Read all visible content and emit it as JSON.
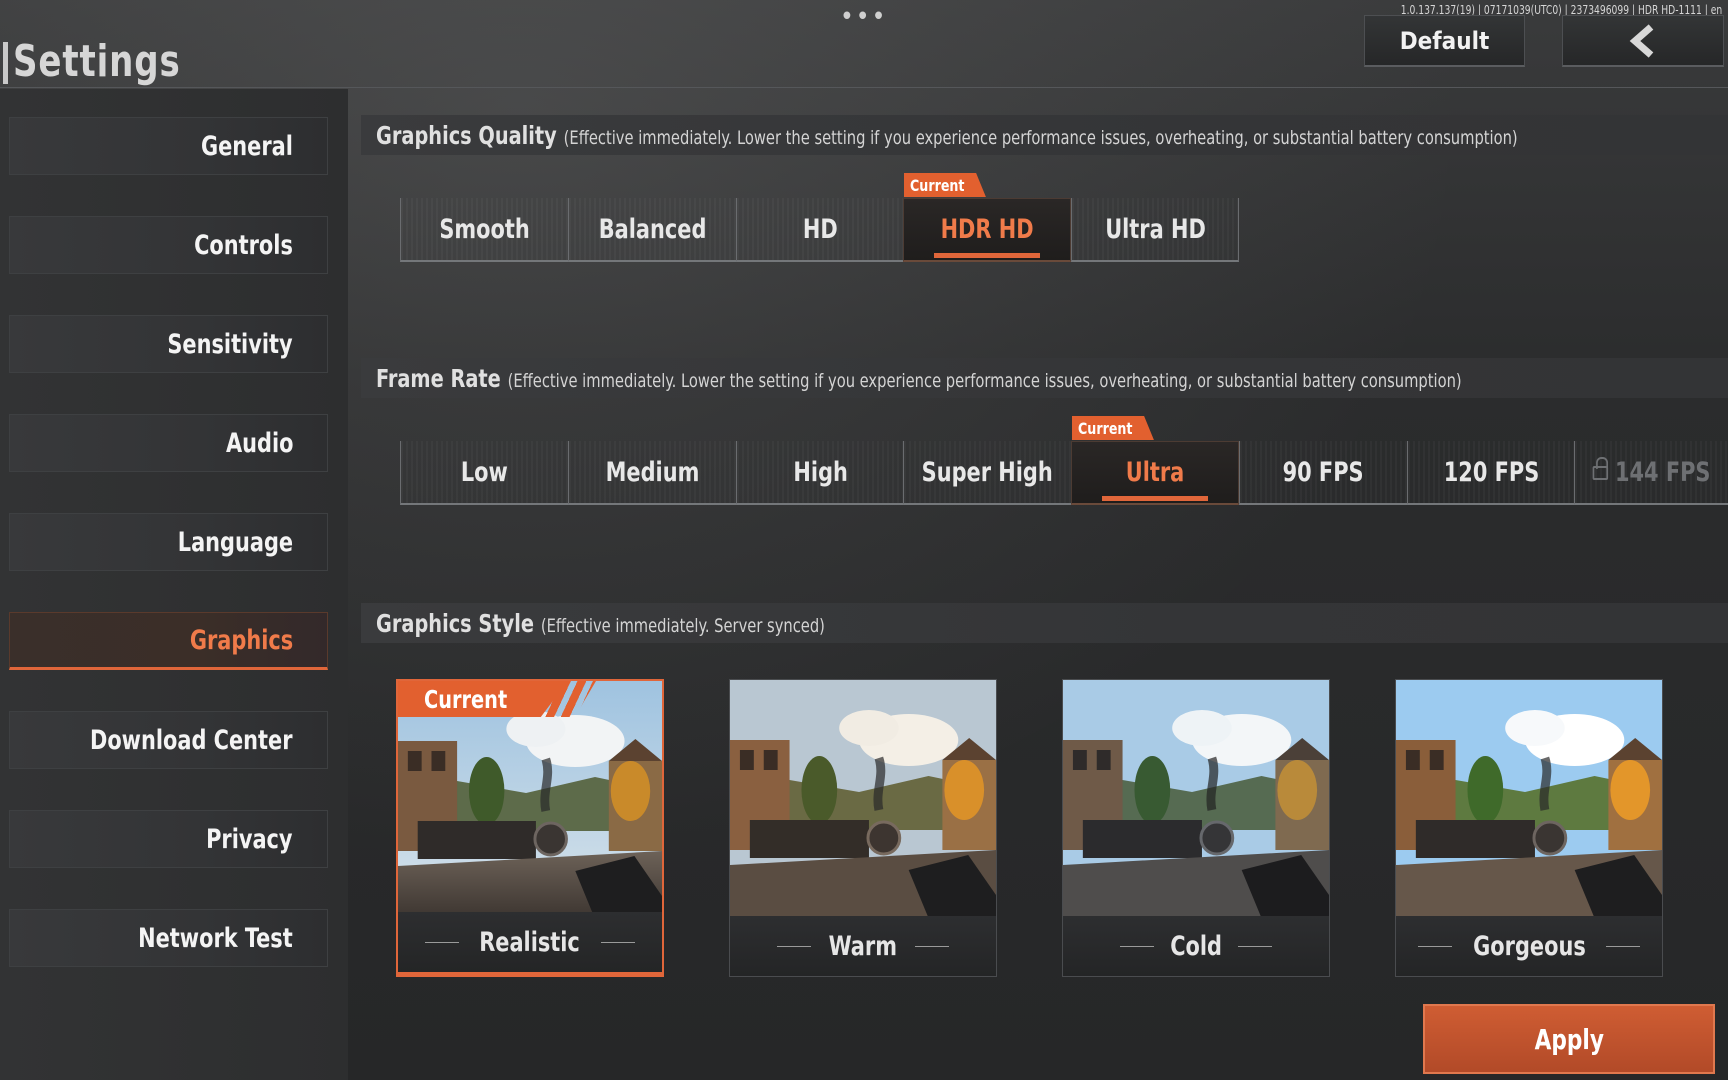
{
  "header": {
    "title": "Settings",
    "more_icon": "ellipsis-icon",
    "version_info": "1.0.137.137(19) | 07171039(UTC0) | 2373496099 | HDR HD-1111 | en",
    "default_label": "Default",
    "back_icon": "chevron-left-icon"
  },
  "sidebar": {
    "items": [
      {
        "label": "General"
      },
      {
        "label": "Controls"
      },
      {
        "label": "Sensitivity"
      },
      {
        "label": "Audio"
      },
      {
        "label": "Language"
      },
      {
        "label": "Graphics",
        "active": true
      },
      {
        "label": "Download Center"
      },
      {
        "label": "Privacy"
      },
      {
        "label": "Network Test"
      }
    ]
  },
  "graphics_quality": {
    "title": "Graphics Quality",
    "note": "(Effective immediately. Lower the setting if you experience performance issues, overheating, or substantial battery consumption)",
    "current_tag": "Current",
    "options": [
      "Smooth",
      "Balanced",
      "HD",
      "HDR HD",
      "Ultra HD"
    ],
    "selected": "HDR HD"
  },
  "frame_rate": {
    "title": "Frame Rate",
    "note": "(Effective immediately. Lower the setting if you experience performance issues, overheating, or substantial battery consumption)",
    "current_tag": "Current",
    "options": [
      "Low",
      "Medium",
      "High",
      "Super High",
      "Ultra",
      "90 FPS",
      "120 FPS",
      "144 FPS"
    ],
    "selected": "Ultra",
    "locked": "144 FPS",
    "locked_icon": "lock-icon"
  },
  "graphics_style": {
    "title": "Graphics Style",
    "note": "(Effective immediately. Server synced)",
    "current_tag": "Current",
    "styles": [
      "Realistic",
      "Warm",
      "Cold",
      "Gorgeous"
    ],
    "selected": "Realistic"
  },
  "apply_label": "Apply",
  "colors": {
    "accent": "#e0663a",
    "background": "#2e2f30"
  }
}
